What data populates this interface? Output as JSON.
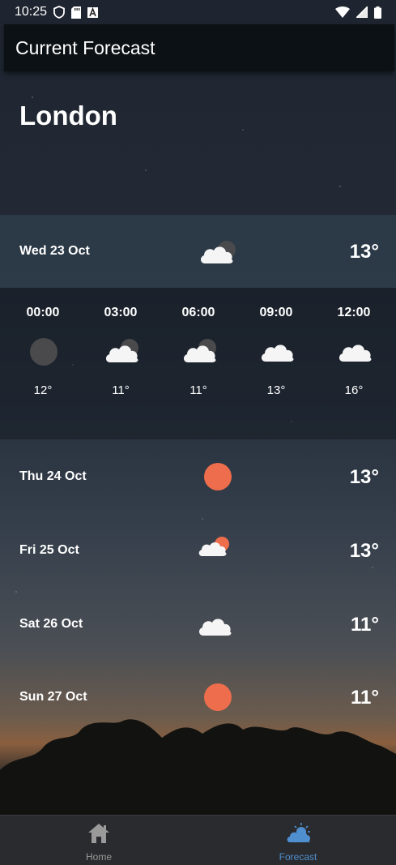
{
  "status_bar": {
    "time": "10:25",
    "icons": [
      "shield-icon",
      "sd-card-icon",
      "a-icon",
      "wifi-icon",
      "signal-icon",
      "battery-icon"
    ]
  },
  "app_bar": {
    "title": "Current Forecast"
  },
  "city": "London",
  "today": {
    "date": "Wed 23 Oct",
    "temp": "13°",
    "icon": "partly-cloudy-night-icon"
  },
  "hourly": [
    {
      "time": "00:00",
      "temp": "12°",
      "icon": "moon-icon"
    },
    {
      "time": "03:00",
      "temp": "11°",
      "icon": "partly-cloudy-night-icon"
    },
    {
      "time": "06:00",
      "temp": "11°",
      "icon": "partly-cloudy-night-icon"
    },
    {
      "time": "09:00",
      "temp": "13°",
      "icon": "cloud-icon"
    },
    {
      "time": "12:00",
      "temp": "16°",
      "icon": "cloud-icon"
    }
  ],
  "daily": [
    {
      "date": "Thu 24 Oct",
      "temp": "13°",
      "icon": "sun-icon"
    },
    {
      "date": "Fri 25 Oct",
      "temp": "13°",
      "icon": "partly-cloudy-day-icon"
    },
    {
      "date": "Sat 26 Oct",
      "temp": "11°",
      "icon": "cloud-icon"
    },
    {
      "date": "Sun 27 Oct",
      "temp": "11°",
      "icon": "sun-icon"
    }
  ],
  "nav": {
    "home_label": "Home",
    "forecast_label": "Forecast",
    "active": "Forecast",
    "active_color": "#4f8fd0",
    "inactive_color": "#9a9a9a"
  },
  "colors": {
    "sun": "#ee6d4c",
    "moon": "#4a4a4c",
    "cloud": "#f5f5f5"
  }
}
